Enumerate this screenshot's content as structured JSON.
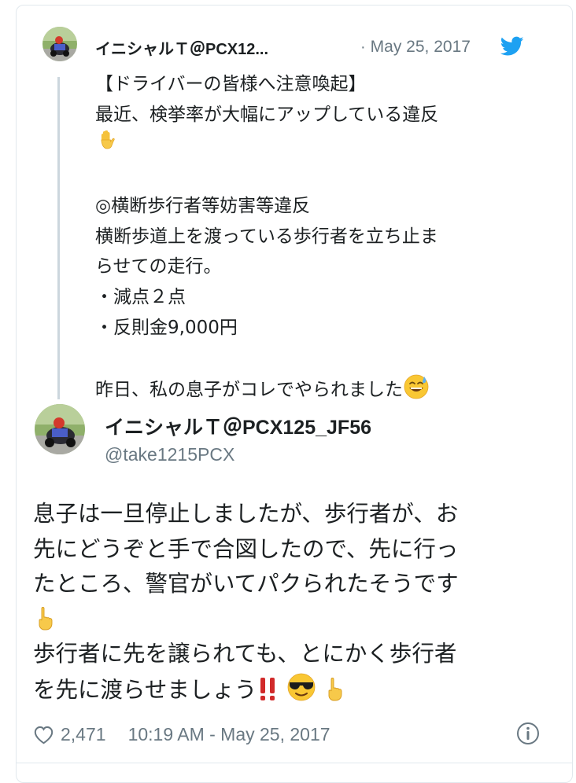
{
  "quoted_tweet": {
    "display_name": "イニシャルＴ＠PCX12...",
    "separator": "·",
    "date": "May 25, 2017",
    "lines": [
      "【ドライバーの皆様へ注意喚起】",
      "最近、検挙率が大幅にアップしている違反",
      "",
      "",
      "◎横断歩行者等妨害等違反",
      "横断歩道上を渡っている歩行者を立ち止ま",
      "らせての走行。",
      "・減点２点",
      "・反則金9,000円",
      "",
      "昨日、私の息子がコレでやられました"
    ],
    "emojis": [
      "raised-hand-emoji",
      "sweat-smile-emoji"
    ]
  },
  "main_tweet": {
    "display_name": "イニシャルＴ＠PCX125_JF56",
    "handle": "@take1215PCX",
    "lines": [
      "息子は一旦停止しましたが、歩行者が、お",
      "先にどうぞと手で合図したので、先に行っ",
      "たところ、警官がいてパクられたそうです",
      "",
      "歩行者に先を譲られても、とにかく歩行者",
      "を先に渡らせましょう"
    ],
    "emojis": [
      "pointing-up-emoji",
      "double-exclamation-emoji",
      "sunglasses-emoji",
      "pointing-up-emoji"
    ]
  },
  "footer": {
    "likes": "2,471",
    "timestamp": "10:19 AM - May 25, 2017"
  },
  "icons": {
    "bird": "twitter-bird-icon",
    "heart": "heart-icon",
    "info": "info-icon"
  },
  "colors": {
    "brand_blue": "#1da1f2",
    "text": "#1c2022",
    "muted": "#697882",
    "border": "#e1e8ed",
    "thread_line": "#ccd6dd"
  }
}
